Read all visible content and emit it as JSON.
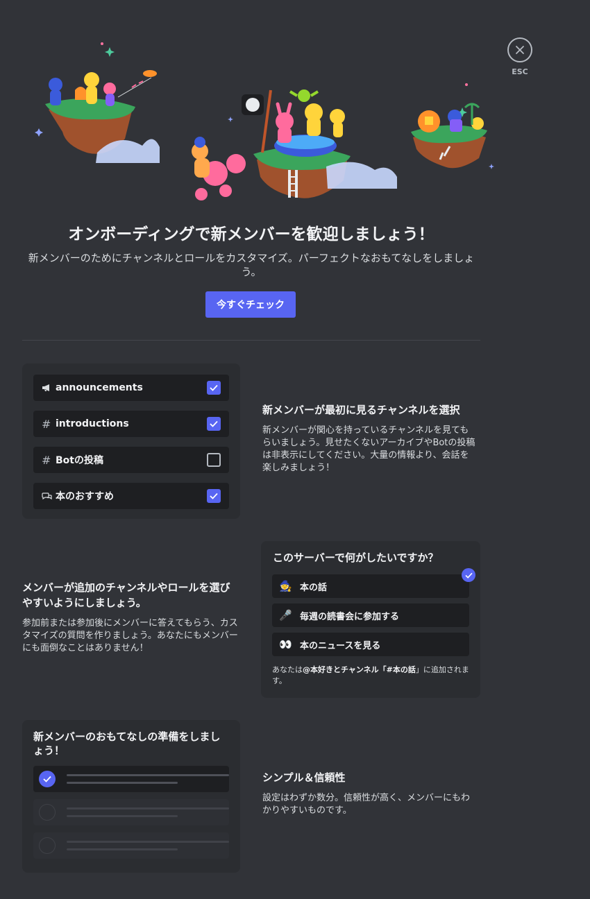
{
  "close": {
    "esc_label": "ESC"
  },
  "hero": {
    "title": "オンボーディングで新メンバーを歓迎しましょう！",
    "subtitle": "新メンバーのためにチャンネルとロールをカスタマイズ。パーフェクトなおもてなしをしましょう。",
    "cta_label": "今すぐチェック"
  },
  "channels_card": {
    "items": [
      {
        "icon": "megaphone-icon",
        "label": "announcements",
        "checked": true
      },
      {
        "icon": "hash-icon",
        "label": "introductions",
        "checked": true
      },
      {
        "icon": "hash-icon",
        "label": "Botの投稿",
        "checked": false
      },
      {
        "icon": "forum-icon",
        "label": "本のおすすめ",
        "checked": true
      }
    ]
  },
  "section1": {
    "title": "新メンバーが最初に見るチャンネルを選択",
    "body": "新メンバーが関心を持っているチャンネルを見てもらいましょう。見せたくないアーカイブやBotの投稿は非表示にしてください。大量の情報より、会話を楽しみましょう！"
  },
  "section2": {
    "title": "メンバーが追加のチャンネルやロールを選びやすいようにしましょう。",
    "body": "参加前または参加後にメンバーに答えてもらう、カスタマイズの質問を作りましょう。あなたにもメンバーにも面倒なことはありません！"
  },
  "question_card": {
    "question": "このサーバーで何がしたいですか？",
    "options": [
      {
        "emoji": "🧙",
        "label": "本の話",
        "selected": true
      },
      {
        "emoji": "🎤",
        "label": "毎週の読書会に参加する",
        "selected": false
      },
      {
        "emoji": "👀",
        "label": "本のニュースを見る",
        "selected": false
      }
    ],
    "note_prefix": "あなたは",
    "note_role": "@本好き",
    "note_mid": "とチャンネル「",
    "note_channel": "#本の話",
    "note_suffix": "」に追加されます。"
  },
  "welcome_card": {
    "title": "新メンバーのおもてなしの準備をしましょう！"
  },
  "section3": {
    "title": "シンプル＆信頼性",
    "body": "設定はわずか数分。信頼性が高く、メンバーにもわかりやすいものです。"
  },
  "colors": {
    "accent": "#5865f2",
    "background": "#313338",
    "card": "#2b2d31",
    "row": "#1e1f22"
  }
}
